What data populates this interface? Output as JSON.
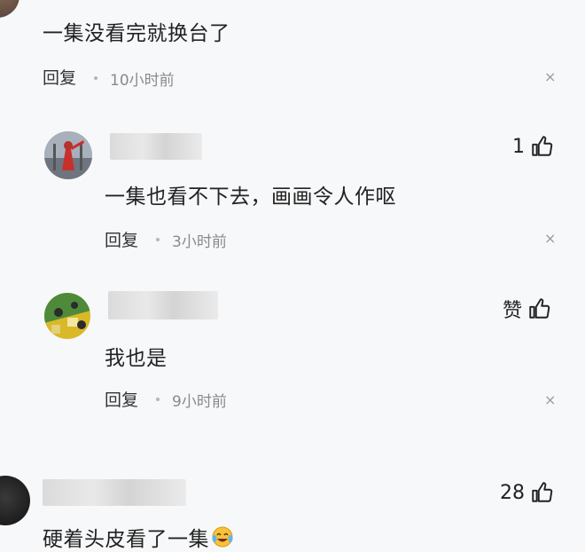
{
  "comments": [
    {
      "text": "一集没看完就换台了",
      "reply_label": "回复",
      "time": "10小时前",
      "close_glyph": "×"
    },
    {
      "text": "一集也看不下去，画画令人作呕",
      "reply_label": "回复",
      "time": "3小时前",
      "like_count": "1",
      "close_glyph": "×"
    },
    {
      "text": "我也是",
      "reply_label": "回复",
      "time": "9小时前",
      "like_label": "赞",
      "close_glyph": "×"
    },
    {
      "text": "硬着头皮看了一集",
      "like_count": "28"
    }
  ],
  "colors": {
    "background": "#f7f8fa",
    "text": "#222222",
    "meta": "#8a8a8a"
  },
  "icons": [
    "thumbs-up-icon",
    "close-icon"
  ]
}
